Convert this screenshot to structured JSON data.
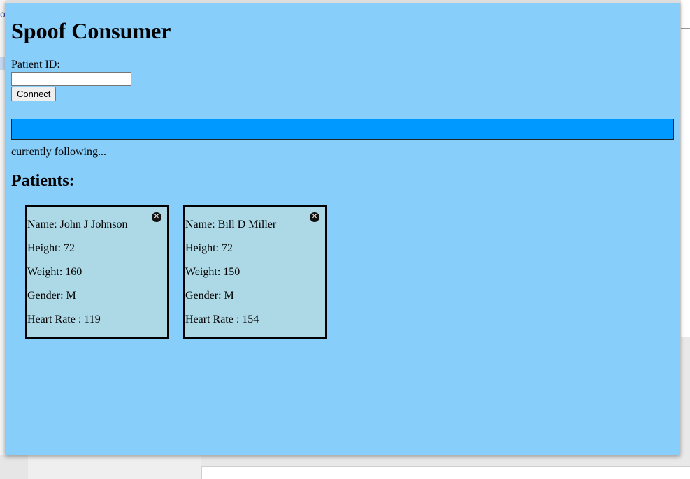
{
  "app": {
    "title": "Spoof Consumer"
  },
  "form": {
    "patient_id_label": "Patient ID:",
    "patient_id_value": "",
    "patient_id_placeholder": "",
    "connect_label": "Connect"
  },
  "status": {
    "following_text": "currently following...",
    "bar_color": "#0099ff"
  },
  "patients": {
    "heading": "Patients:",
    "cards": [
      {
        "name": "Name: John J Johnson",
        "height": "Height: 72",
        "weight": "Weight: 160",
        "gender": "Gender: M",
        "heart_rate": "Heart Rate : 119",
        "close_glyph": "✕"
      },
      {
        "name": "Name: Bill D Miller",
        "height": "Height: 72",
        "weight": "Weight: 150",
        "gender": "Gender: M",
        "heart_rate": "Heart Rate : 154",
        "close_glyph": "✕"
      }
    ]
  },
  "background": {
    "left_mark": "o"
  },
  "colors": {
    "window_bg": "#87cefa",
    "card_bg": "#add8e6",
    "status_bar": "#0099ff"
  },
  "icons": {
    "close": "close-icon"
  }
}
